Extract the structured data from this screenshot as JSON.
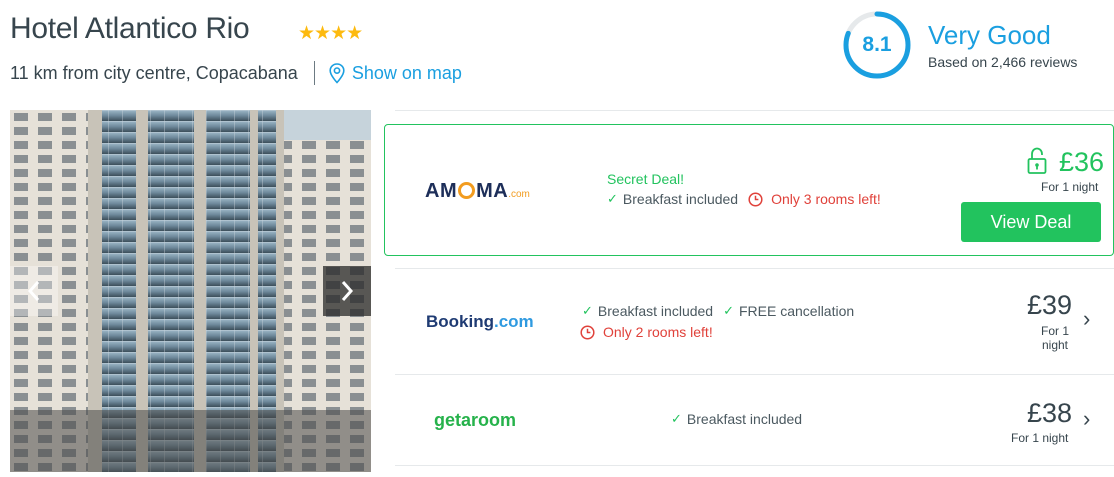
{
  "hotel": {
    "name": "Hotel Atlantico Rio",
    "star_rating": 4,
    "stars_display": "★★★★",
    "distance": "11 km from city centre, Copacabana",
    "map_link": "Show on map"
  },
  "rating": {
    "score": "8.1",
    "score_fraction": 0.81,
    "label": "Very Good",
    "reviews": "Based on 2,466 reviews"
  },
  "gallery": {
    "prev_icon": "chevron-left-icon",
    "next_icon": "chevron-right-icon"
  },
  "deals": [
    {
      "provider": "AMOMA.com",
      "logo_parts": {
        "a": "AM",
        "b": "MA",
        "com": ".com"
      },
      "badge": "Secret Deal!",
      "features": [
        "Breakfast included"
      ],
      "alert": "Only 3 rooms left!",
      "price": "£36",
      "per": "For 1 night",
      "button": "View Deal",
      "icon": "unlock-icon"
    },
    {
      "provider": "Booking.com",
      "logo_parts": {
        "name": "Booking",
        "com": ".com"
      },
      "features": [
        "Breakfast included",
        "FREE cancellation"
      ],
      "alert": "Only 2 rooms left!",
      "price": "£39",
      "per_line1": "For 1",
      "per_line2": "night"
    },
    {
      "provider": "getaroom",
      "features": [
        "Breakfast included"
      ],
      "price": "£38",
      "per": "For 1 night"
    }
  ],
  "colors": {
    "accent_blue": "#1a9fe0",
    "deal_green": "#22c35e",
    "alert_red": "#e0413a",
    "star_yellow": "#fdba0f",
    "text": "#37454d"
  }
}
